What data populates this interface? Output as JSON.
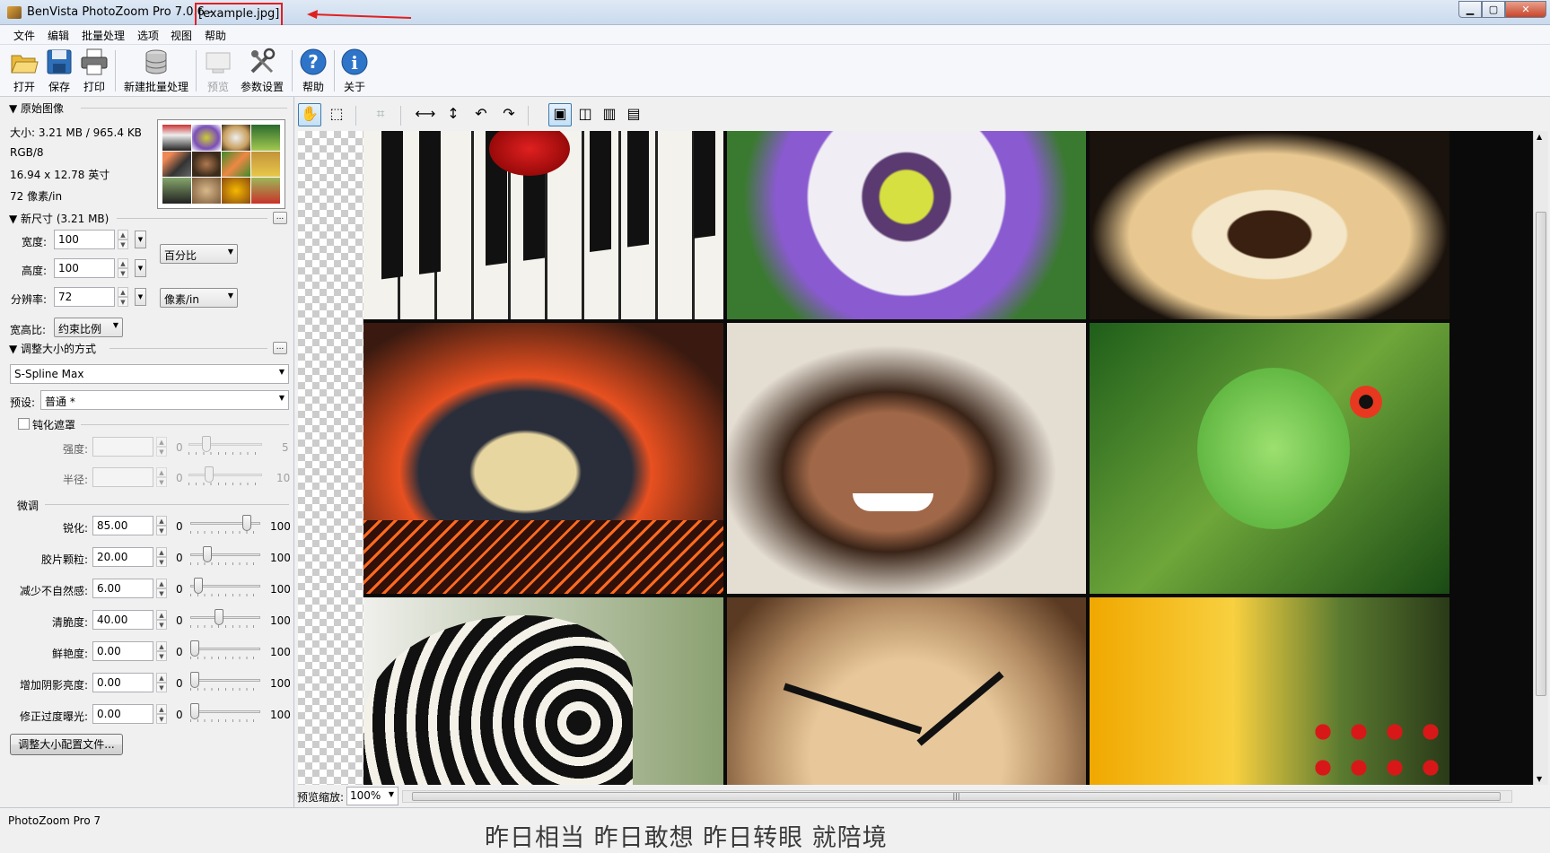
{
  "window": {
    "title": "BenVista PhotoZoom Pro 7.0.6 - ",
    "file": "[example.jpg]",
    "min": "▁",
    "max": "▢",
    "close": "✕"
  },
  "menu": [
    "文件",
    "编辑",
    "批量处理",
    "选项",
    "视图",
    "帮助"
  ],
  "toolbar": [
    {
      "label": "打开",
      "icon": "open-folder-icon"
    },
    {
      "label": "保存",
      "icon": "save-disk-icon"
    },
    {
      "label": "打印",
      "icon": "printer-icon"
    },
    {
      "label": "新建批量处理",
      "icon": "batch-database-icon"
    },
    {
      "label": "预览",
      "icon": "preview-icon",
      "disabled": true
    },
    {
      "label": "参数设置",
      "icon": "settings-tools-icon"
    },
    {
      "label": "帮助",
      "icon": "help-icon"
    },
    {
      "label": "关于",
      "icon": "info-icon"
    }
  ],
  "original": {
    "header": "▼ 原始图像",
    "size": "大小: 3.21 MB / 965.4 KB",
    "mode": "RGB/8",
    "dims": "16.94 x 12.78 英寸",
    "res": "72 像素/in"
  },
  "newsize": {
    "header": "▼ 新尺寸 (3.21 MB)",
    "ellipsis": "...",
    "width_label": "宽度:",
    "width_value": "100",
    "height_label": "高度:",
    "height_value": "100",
    "res_label": "分辨率:",
    "res_value": "72",
    "unit": "百分比",
    "res_unit": "像素/in",
    "aspect_label": "宽高比:",
    "aspect_value": "约束比例"
  },
  "method": {
    "header": "▼ 调整大小的方式",
    "ellipsis": "...",
    "algorithm": "S-Spline Max",
    "preset_label": "预设:",
    "preset_value": "普通 *"
  },
  "unsharp": {
    "label": "钝化遮罩",
    "checked": false,
    "strength_label": "强度:",
    "strength_min": "0",
    "strength_max": "5",
    "radius_label": "半径:",
    "radius_min": "0",
    "radius_max": "10"
  },
  "finetune": {
    "header": "微调",
    "rows": [
      {
        "label": "锐化:",
        "value": "85.00",
        "min": "0",
        "max": "100",
        "fraction": 0.85
      },
      {
        "label": "胶片颗粒:",
        "value": "20.00",
        "min": "0",
        "max": "100",
        "fraction": 0.2
      },
      {
        "label": "减少不自然感:",
        "value": "6.00",
        "min": "0",
        "max": "100",
        "fraction": 0.06
      },
      {
        "label": "清脆度:",
        "value": "40.00",
        "min": "0",
        "max": "100",
        "fraction": 0.4
      },
      {
        "label": "鲜艳度:",
        "value": "0.00",
        "min": "0",
        "max": "100",
        "fraction": 0.0
      },
      {
        "label": "增加阴影亮度:",
        "value": "0.00",
        "min": "0",
        "max": "100",
        "fraction": 0.0
      },
      {
        "label": "修正过度曝光:",
        "value": "0.00",
        "min": "0",
        "max": "100",
        "fraction": 0.0
      }
    ],
    "profile_button": "调整大小配置文件..."
  },
  "preview": {
    "zoom_label": "预览缩放:",
    "zoom_value": "100%"
  },
  "status": "PhotoZoom Pro 7",
  "caption": "昨日相当 昨日敢想 昨日转眼 就陪境",
  "colors": {
    "accent": "#3d7bad",
    "annotation": "#e02020"
  }
}
